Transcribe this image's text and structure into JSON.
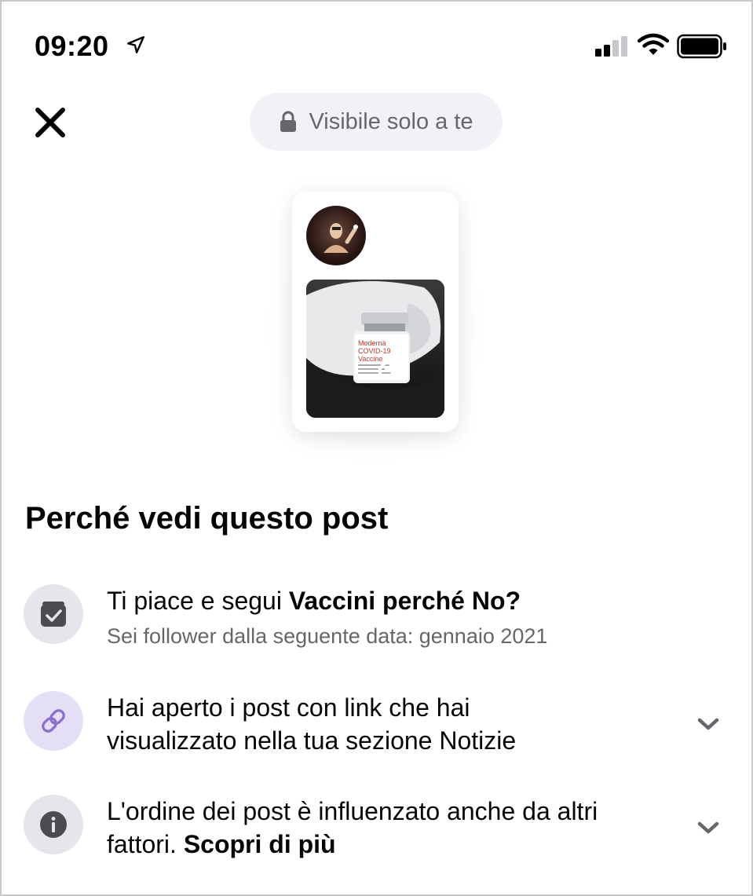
{
  "status_bar": {
    "time": "09:20"
  },
  "header": {
    "visibility_label": "Visibile solo a te"
  },
  "title": "Perché vedi questo post",
  "reasons": [
    {
      "text": "Ti piace e segui ",
      "bold": "Vaccini perché No?",
      "subtext": "Sei follower dalla seguente data: gennaio 2021",
      "icon": "page-check-icon"
    },
    {
      "line1": "Hai aperto i post con link che hai",
      "line2": "visualizzato nella tua sezione Notizie",
      "icon": "link-icon"
    },
    {
      "line1": "L'ordine dei post è influenzato anche da altri",
      "line2": "fattori. ",
      "link": "Scopri di più",
      "icon": "info-icon"
    }
  ],
  "preview": {
    "vial_label_lines": [
      "Moderna",
      "COVID-19",
      "Vaccine"
    ]
  },
  "colors": {
    "icon_bg": "#e4e6eb",
    "link_icon_bg": "#e5dff5",
    "link_icon_color": "#8a6fd1",
    "secondary_text": "#65676b"
  }
}
